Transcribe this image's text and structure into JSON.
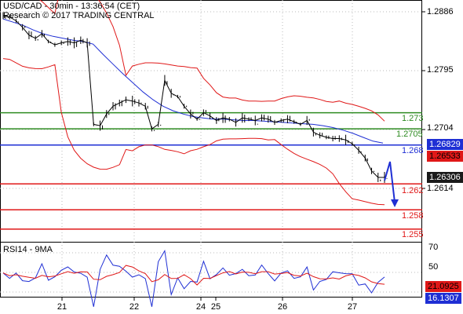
{
  "header": {
    "title": "USD/CAD - 30min - 13:36:54 (CET)",
    "credit": "Research © 2017 TRADING CENTRAL"
  },
  "price_axis": {
    "labels": [
      "1.2886",
      "1.2795",
      "1.2704",
      "1.2614"
    ]
  },
  "levels": [
    {
      "label": "1.273",
      "value": 1.273,
      "color": "#2e8b22"
    },
    {
      "label": "1.2705",
      "value": 1.2705,
      "color": "#2e8b22"
    },
    {
      "label": "1.268",
      "value": 1.268,
      "color": "#1f2fd4"
    },
    {
      "label": "1.262",
      "value": 1.262,
      "color": "#e01818"
    },
    {
      "label": "1.258",
      "value": 1.258,
      "color": "#e01818"
    },
    {
      "label": "1.255",
      "value": 1.255,
      "color": "#e01818"
    }
  ],
  "price_tags": [
    {
      "label": "1.26829",
      "color": "#1f2fd4",
      "text_color": "#ffffff"
    },
    {
      "label": "1.26533",
      "color": "#e01818",
      "text_color": "#000000"
    },
    {
      "label": "1.26306",
      "color": "#1a1a1a",
      "text_color": "#ffffff"
    }
  ],
  "rsi": {
    "title": "RSI14 - 9MA",
    "axis_labels": [
      "70",
      "50",
      "30"
    ],
    "tags": [
      {
        "label": "21.0925",
        "color": "#e01818",
        "text_color": "#000000"
      },
      {
        "label": "16.1307",
        "color": "#1f2fd4",
        "text_color": "#ffffff"
      }
    ]
  },
  "x_axis": {
    "labels": [
      "21",
      "22",
      "24",
      "25",
      "26",
      "27"
    ]
  },
  "chart_data": {
    "type": "line",
    "title": "USD/CAD - 30min - 13:36:54 (CET)",
    "xlabel": "",
    "ylabel": "",
    "ylim": [
      1.253,
      1.2905
    ],
    "x_tick_labels": [
      "21",
      "22",
      "24",
      "25",
      "26",
      "27"
    ],
    "series": [
      {
        "name": "",
        "color": "#000000",
        "values": [
          1.288,
          1.2878,
          1.2872,
          1.2862,
          1.285,
          1.2845,
          1.2852,
          1.284,
          1.2835,
          1.2838,
          1.284,
          1.2838,
          1.2842,
          1.2838,
          1.2712,
          1.271,
          1.2728,
          1.274,
          1.2745,
          1.275,
          1.2748,
          1.2745,
          1.274,
          1.2705,
          1.2712,
          1.278,
          1.276,
          1.2755,
          1.274,
          1.2728,
          1.272,
          1.273,
          1.2725,
          1.2718,
          1.2722,
          1.272,
          1.2715,
          1.2722,
          1.272,
          1.2718,
          1.2722,
          1.272,
          1.2715,
          1.2718,
          1.272,
          1.2716,
          1.2712,
          1.2718,
          1.27,
          1.2695,
          1.2692,
          1.269,
          1.269,
          1.2688,
          1.2682,
          1.2672,
          1.266,
          1.264,
          1.263,
          1.263
        ]
      },
      {
        "name": "",
        "color": "#1f2fd4",
        "values": [
          1.2875,
          1.287,
          1.2865,
          1.2858,
          1.2852,
          1.2848,
          1.2845,
          1.2842,
          1.284,
          1.2836,
          1.282,
          1.2805,
          1.279,
          1.2776,
          1.2762,
          1.275,
          1.274,
          1.2733,
          1.2728,
          1.2724,
          1.2722,
          1.272,
          1.272,
          1.2719,
          1.2718,
          1.2718,
          1.2717,
          1.2716,
          1.2715,
          1.2714,
          1.2713,
          1.2712,
          1.271,
          1.2707,
          1.2703,
          1.2698,
          1.2692,
          1.2686,
          1.2683
        ]
      }
    ]
  }
}
